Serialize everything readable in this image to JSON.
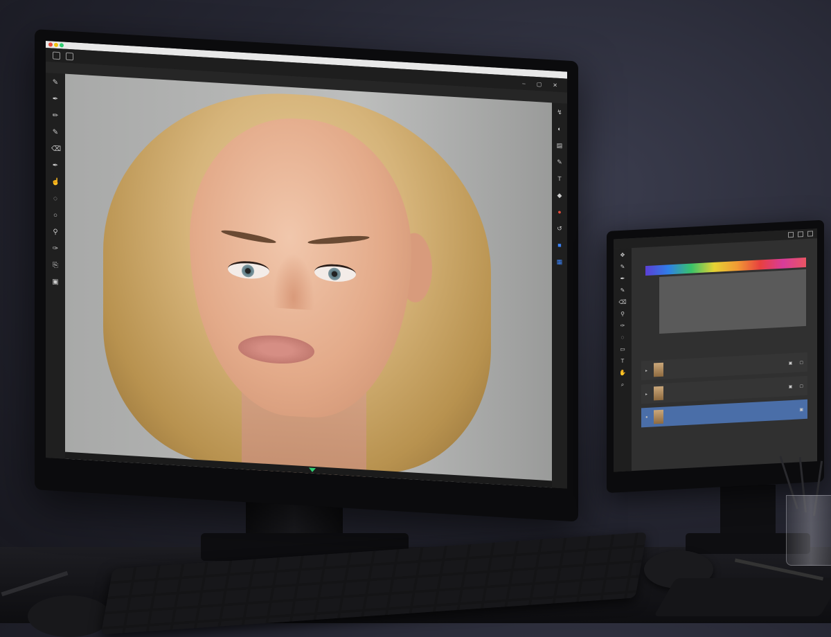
{
  "main_monitor": {
    "brand": "",
    "app": {
      "menu_items": [
        "",
        "",
        "",
        "",
        "",
        "",
        ""
      ],
      "options_bar": [
        "",
        ""
      ],
      "window_controls": [
        "–",
        "▢",
        "✕"
      ],
      "left_tools": [
        "brush-icon",
        "pen-icon",
        "pencil-icon",
        "brush-icon",
        "eraser-icon",
        "pen-icon",
        "smudge-icon",
        "lasso-icon",
        "circle-icon",
        "dropper-icon",
        "pen-icon",
        "clone-icon",
        "color-swatch-icon"
      ],
      "right_tools": [
        "arrow-icon",
        "adjust-icon",
        "layers-icon",
        "brush-icon",
        "text-icon",
        "shape-icon",
        "color-icon",
        "history-icon",
        "properties-icon",
        "channels-icon"
      ]
    }
  },
  "secondary_monitor": {
    "brand": "",
    "panel": {
      "layers": [
        {
          "name": "",
          "selected": false
        },
        {
          "name": "",
          "selected": false
        },
        {
          "name": "",
          "selected": true
        }
      ]
    }
  },
  "colors": {
    "accent_selected": "#4a6ea8",
    "indicator": "#2ecc71"
  }
}
